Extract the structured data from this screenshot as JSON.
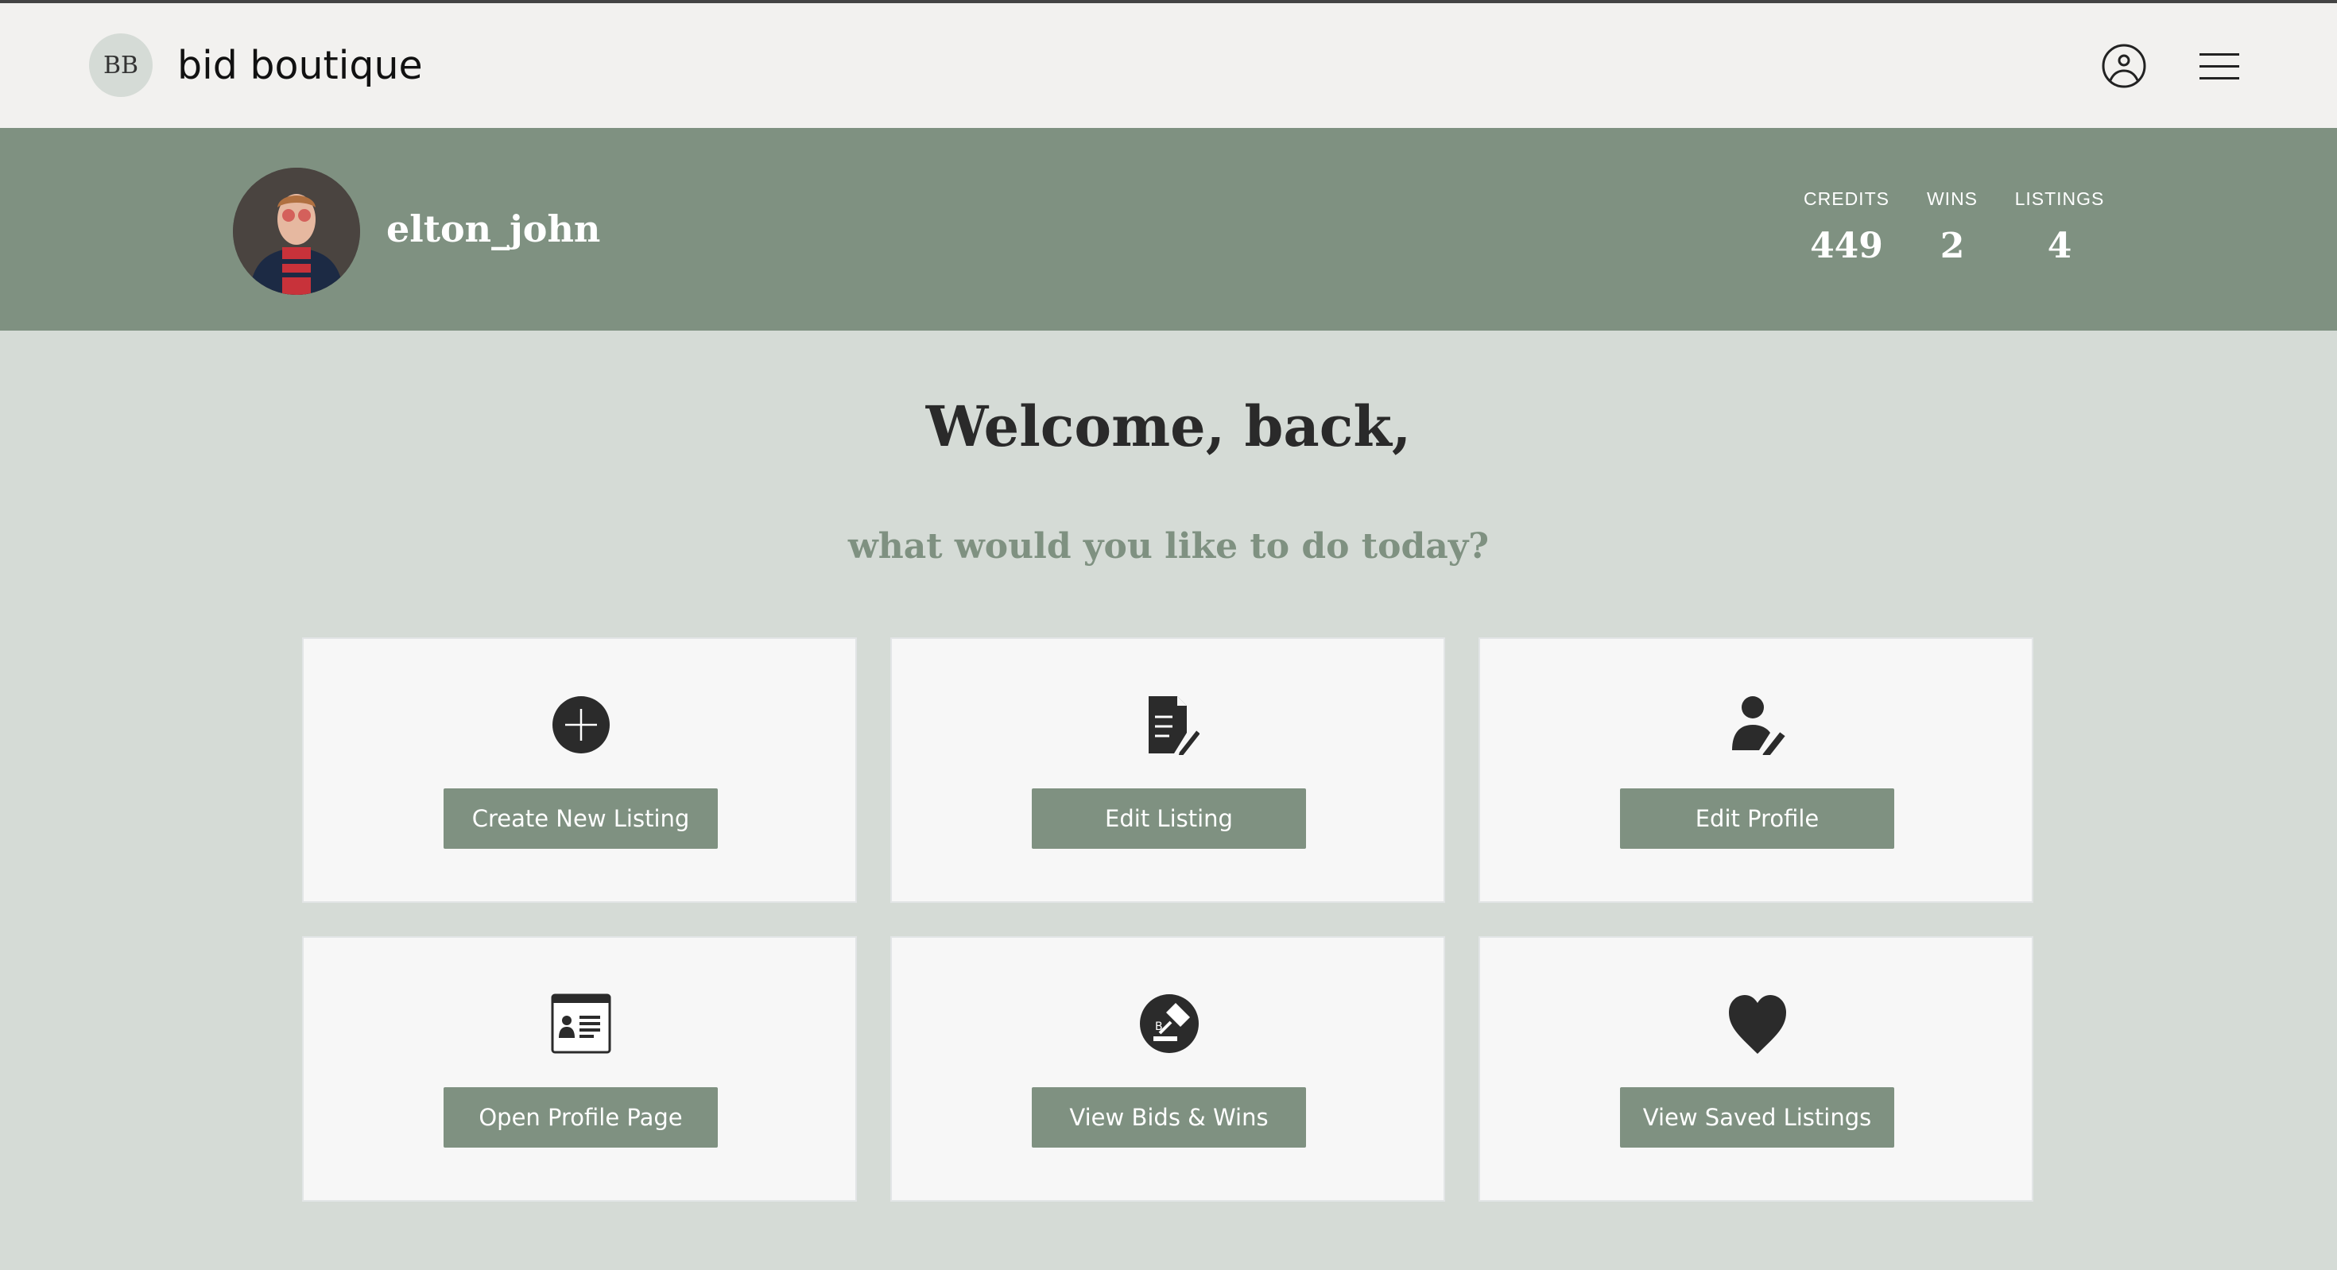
{
  "header": {
    "logo_initials": "BB",
    "brand": "bid boutique"
  },
  "profile": {
    "username": "elton_john",
    "stats": [
      {
        "label": "CREDITS",
        "value": "449"
      },
      {
        "label": "WINS",
        "value": "2"
      },
      {
        "label": "LISTINGS",
        "value": "4"
      }
    ]
  },
  "main": {
    "title": "Welcome, back,",
    "subtitle": "what would you like to do today?",
    "actions": [
      {
        "label": "Create New Listing",
        "icon": "plus-circle-icon"
      },
      {
        "label": "Edit Listing",
        "icon": "document-edit-icon"
      },
      {
        "label": "Edit Profile",
        "icon": "user-edit-icon"
      },
      {
        "label": "Open Profile Page",
        "icon": "profile-card-icon"
      },
      {
        "label": "View Bids & Wins",
        "icon": "gavel-icon"
      },
      {
        "label": "View Saved Listings",
        "icon": "heart-icon"
      }
    ]
  },
  "colors": {
    "accent": "#7f9181",
    "background": "#d5dbd6",
    "header": "#f2f1ef"
  }
}
